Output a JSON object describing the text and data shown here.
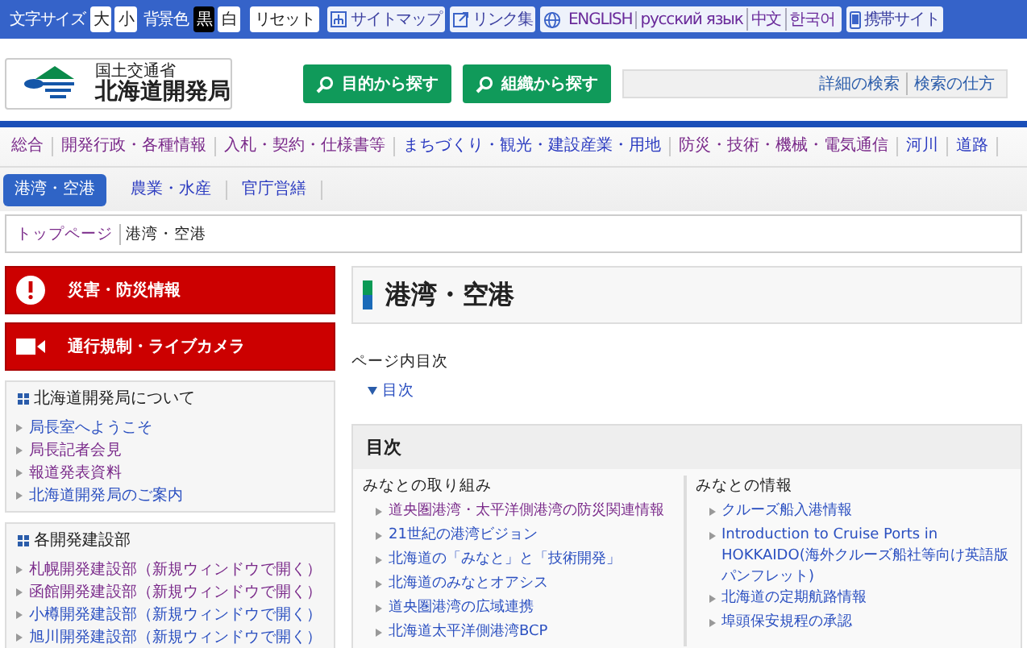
{
  "utility_bar": {
    "font_size_label": "文字サイズ",
    "font_sizes": [
      {
        "label": "大",
        "selected": false
      },
      {
        "label": "小",
        "selected": false
      }
    ],
    "bg_label": "背景色",
    "bg_colors": [
      {
        "label": "黒",
        "selected": true
      },
      {
        "label": "白",
        "selected": false
      }
    ],
    "reset": "リセット",
    "sitemap": "サイトマップ",
    "links": "リンク集",
    "languages": [
      "ENGLISH",
      "русский язык",
      "中文",
      "한국어"
    ],
    "mobile": "携帯サイト"
  },
  "header": {
    "logo_small": "国土交通省",
    "logo_large": "北海道開発局",
    "search_buttons": [
      "目的から探す",
      "組織から探す"
    ],
    "search_links": [
      "詳細の検索",
      "検索の仕方"
    ]
  },
  "nav_primary": [
    {
      "label": "総合",
      "visited": true
    },
    {
      "label": "開発行政・各種情報",
      "visited": true
    },
    {
      "label": "入札・契約・仕様書等",
      "visited": true
    },
    {
      "label": "まちづくり・観光・建設産業・用地",
      "visited": false
    },
    {
      "label": "防災・技術・機械・電気通信",
      "visited": true
    },
    {
      "label": "河川",
      "visited": false
    },
    {
      "label": "道路",
      "visited": false
    }
  ],
  "nav_secondary": [
    {
      "label": "港湾・空港",
      "selected": true
    },
    {
      "label": "農業・水産",
      "selected": false
    },
    {
      "label": "官庁営繕",
      "selected": false
    }
  ],
  "breadcrumb": {
    "home": "トップページ",
    "current": "港湾・空港"
  },
  "sidebar": {
    "alerts": [
      {
        "label": "災害・防災情報",
        "kind": "alert"
      },
      {
        "label": "通行規制・ライブカメラ",
        "kind": "camera"
      }
    ],
    "sections": [
      {
        "title": "北海道開発局について",
        "items": [
          {
            "label": "局長室へようこそ",
            "visited": false
          },
          {
            "label": "局長記者会見",
            "visited": true
          },
          {
            "label": "報道発表資料",
            "visited": true
          },
          {
            "label": "北海道開発局のご案内",
            "visited": false
          }
        ]
      },
      {
        "title": "各開発建設部",
        "items": [
          {
            "label": "札幌開発建設部",
            "note": "（新規ウィンドウで開く）",
            "visited": true
          },
          {
            "label": "函館開発建設部",
            "note": "（新規ウィンドウで開く）",
            "visited": true
          },
          {
            "label": "小樽開発建設部",
            "note": "（新規ウィンドウで開く）",
            "visited": false
          },
          {
            "label": "旭川開発建設部",
            "note": "（新規ウィンドウで開く）",
            "visited": false
          }
        ]
      }
    ]
  },
  "main": {
    "title": "港湾・空港",
    "page_toc_label": "ページ内目次",
    "page_toc_link": "目次",
    "toc": {
      "title": "目次",
      "columns": [
        {
          "heading": "みなとの取り組み",
          "items": [
            {
              "label": "道央圏港湾・太平洋側港湾の防災関連情報",
              "visited": true
            },
            {
              "label": "21世紀の港湾ビジョン",
              "visited": false
            },
            {
              "label": "北海道の「みなと」と「技術開発」",
              "visited": false
            },
            {
              "label": "北海道のみなとオアシス",
              "visited": false
            },
            {
              "label": "道央圏港湾の広域連携",
              "visited": false
            },
            {
              "label": "北海道太平洋側港湾BCP",
              "visited": false
            }
          ]
        },
        {
          "heading": "みなとの情報",
          "items": [
            {
              "label": "クルーズ船入港情報",
              "visited": false
            },
            {
              "label": "Introduction to Cruise Ports in HOKKAIDO(海外クルーズ船社等向け英語版パンフレット)",
              "visited": false
            },
            {
              "label": "北海道の定期航路情報",
              "visited": false
            },
            {
              "label": "埠頭保安規程の承認",
              "visited": false
            }
          ]
        }
      ]
    }
  }
}
